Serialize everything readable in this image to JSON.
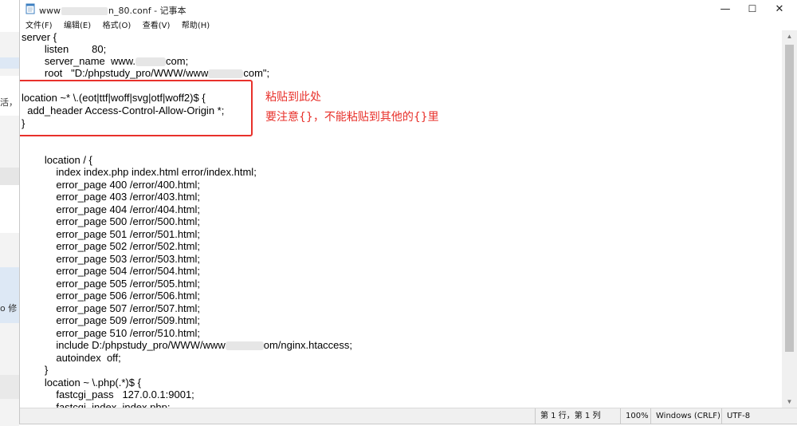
{
  "window": {
    "title_prefix": "www",
    "title_suffix": "n_80.conf - 记事本",
    "controls": {
      "minimize": "—",
      "maximize": "☐",
      "close": "✕"
    }
  },
  "menu": {
    "items": [
      "文件(F)",
      "编辑(E)",
      "格式(O)",
      "查看(V)",
      "帮助(H)"
    ]
  },
  "editor": {
    "lines": [
      "server {",
      "        listen        80;",
      "        server_name  www.",
      "        root   \"D:/phpstudy_pro/WWW/www",
      "",
      "location ~* \\.(eot|ttf|woff|svg|otf|woff2)$ {",
      "  add_header Access-Control-Allow-Origin *;",
      "}",
      "",
      "",
      "        location / {",
      "            index index.php index.html error/index.html;",
      "            error_page 400 /error/400.html;",
      "            error_page 403 /error/403.html;",
      "            error_page 404 /error/404.html;",
      "            error_page 500 /error/500.html;",
      "            error_page 501 /error/501.html;",
      "            error_page 502 /error/502.html;",
      "            error_page 503 /error/503.html;",
      "            error_page 504 /error/504.html;",
      "            error_page 505 /error/505.html;",
      "            error_page 506 /error/506.html;",
      "            error_page 507 /error/507.html;",
      "            error_page 509 /error/509.html;",
      "            error_page 510 /error/510.html;",
      "            include D:/phpstudy_pro/WWW/www",
      "            autoindex  off;",
      "        }",
      "        location ~ \\.php(.*)$ {",
      "            fastcgi_pass   127.0.0.1:9001;",
      "            fastcgi_index  index.php;"
    ],
    "line_tails": {
      "server_name": "com;",
      "root": "com\";",
      "include": "om/nginx.htaccess;"
    }
  },
  "annotation": {
    "line1": "粘贴到此处",
    "line2": "要注意{}，不能粘贴到其他的{}里"
  },
  "statusbar": {
    "position": "第 1 行，第 1 列",
    "zoom": "100%",
    "line_ending": "Windows (CRLF)",
    "encoding": "UTF-8"
  },
  "background_window": {
    "text1": "活，",
    "text2": "o 修"
  }
}
